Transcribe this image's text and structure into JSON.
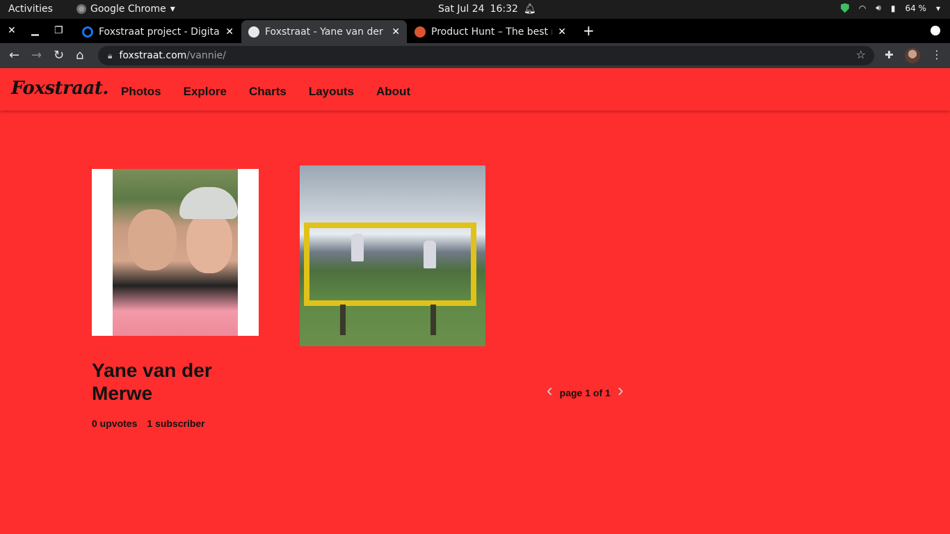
{
  "system_bar": {
    "activities": "Activities",
    "app_name": "Google Chrome",
    "date": "Sat Jul 24",
    "time": "16:32",
    "battery": "64 %"
  },
  "tabs": [
    {
      "title": "Foxstraat project - Digital",
      "favicon_color": "#1a73e8",
      "active": false
    },
    {
      "title": "Foxstraat - Yane van der M",
      "favicon_color": "#ffffff",
      "active": true
    },
    {
      "title": "Product Hunt – The best n",
      "favicon_color": "#da552f",
      "active": false
    }
  ],
  "address_bar": {
    "domain": "foxstraat.com",
    "path": "/vannie/"
  },
  "site": {
    "logo": "Foxstraat.",
    "nav": [
      "Photos",
      "Explore",
      "Charts",
      "Layouts",
      "About"
    ],
    "accent_color": "#ff2e2e"
  },
  "profile": {
    "name": "Yane van der Merwe",
    "upvotes": "0 upvotes",
    "subscribers": "1 subscriber"
  },
  "pagination": {
    "label": "page 1 of 1",
    "prev_icon": "chevron-left-icon",
    "next_icon": "chevron-right-icon"
  }
}
